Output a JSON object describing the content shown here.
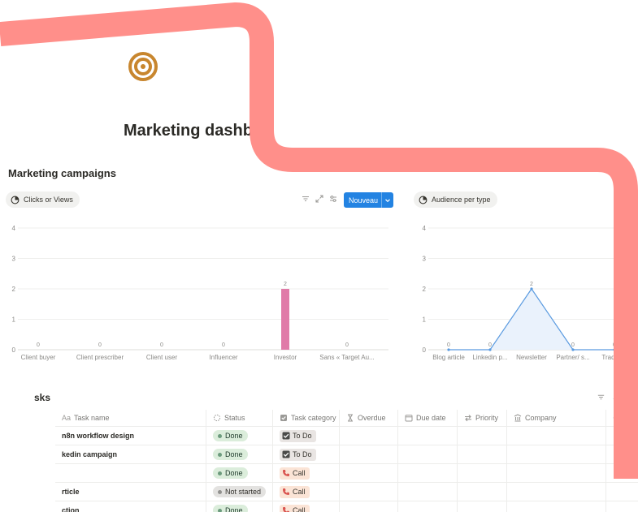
{
  "page": {
    "icon": "target-icon",
    "title": "Marketing dashbo",
    "section_title": "Marketing campaigns"
  },
  "colors": {
    "accent": "#2383e2",
    "icon_color": "#c8862e",
    "bar_color": "#e07ba8",
    "line_color": "#5b9be0",
    "decor_shape": "#ff8f8a"
  },
  "views": {
    "clicks": {
      "label": "Clicks or Views",
      "icon": "pie-chart-icon"
    },
    "audience": {
      "label": "Audience per type",
      "icon": "pie-chart-icon"
    }
  },
  "toolbar": {
    "new_label": "Nouveau",
    "icons": [
      "filter-icon",
      "expand-icon",
      "settings-icon",
      "chevron-down-icon"
    ]
  },
  "chart_data": [
    {
      "type": "bar",
      "categories": [
        "Client buyer",
        "Client prescriber",
        "Client user",
        "Influencer",
        "Investor",
        "Sans « Target Au..."
      ],
      "values": [
        0,
        0,
        0,
        0,
        2,
        0
      ],
      "yticks": [
        "0",
        "1",
        "2",
        "3",
        "4"
      ],
      "ylim": [
        0,
        4
      ],
      "grid": true
    },
    {
      "type": "line",
      "categories": [
        "Blog article",
        "Linkedin p...",
        "Newsletter",
        "Partner/ s...",
        "Trade sh"
      ],
      "values": [
        0,
        0,
        2,
        0,
        0
      ],
      "yticks": [
        "0",
        "1",
        "2",
        "3",
        "4"
      ],
      "ylim": [
        0,
        4
      ],
      "grid": true
    }
  ],
  "tasks": {
    "title": "sks",
    "tool_icons": [
      "filter-icon",
      "sort-icon"
    ],
    "columns": [
      {
        "label": "Task name",
        "icon": "Aa"
      },
      {
        "label": "Status",
        "icon": "status-icon"
      },
      {
        "label": "Task category",
        "icon": "checkbox-icon"
      },
      {
        "label": "Overdue",
        "icon": "hourglass-icon"
      },
      {
        "label": "Due date",
        "icon": "calendar-icon"
      },
      {
        "label": "Priority",
        "icon": "arrows-icon"
      },
      {
        "label": "Company",
        "icon": "building-icon"
      },
      {
        "label": "",
        "icon": "person-icon"
      }
    ],
    "rows": [
      {
        "name": "n8n workflow design",
        "status": "Done",
        "status_type": "done",
        "category": "To Do",
        "cat_type": "todo"
      },
      {
        "name": "kedin campaign",
        "status": "Done",
        "status_type": "done",
        "category": "To Do",
        "cat_type": "todo"
      },
      {
        "name": "",
        "status": "Done",
        "status_type": "done",
        "category": "Call",
        "cat_type": "call"
      },
      {
        "name": "rticle",
        "status": "Not started",
        "status_type": "ns",
        "category": "Call",
        "cat_type": "call"
      },
      {
        "name": "ction",
        "status": "Done",
        "status_type": "done",
        "category": "Call",
        "cat_type": "call"
      }
    ]
  }
}
